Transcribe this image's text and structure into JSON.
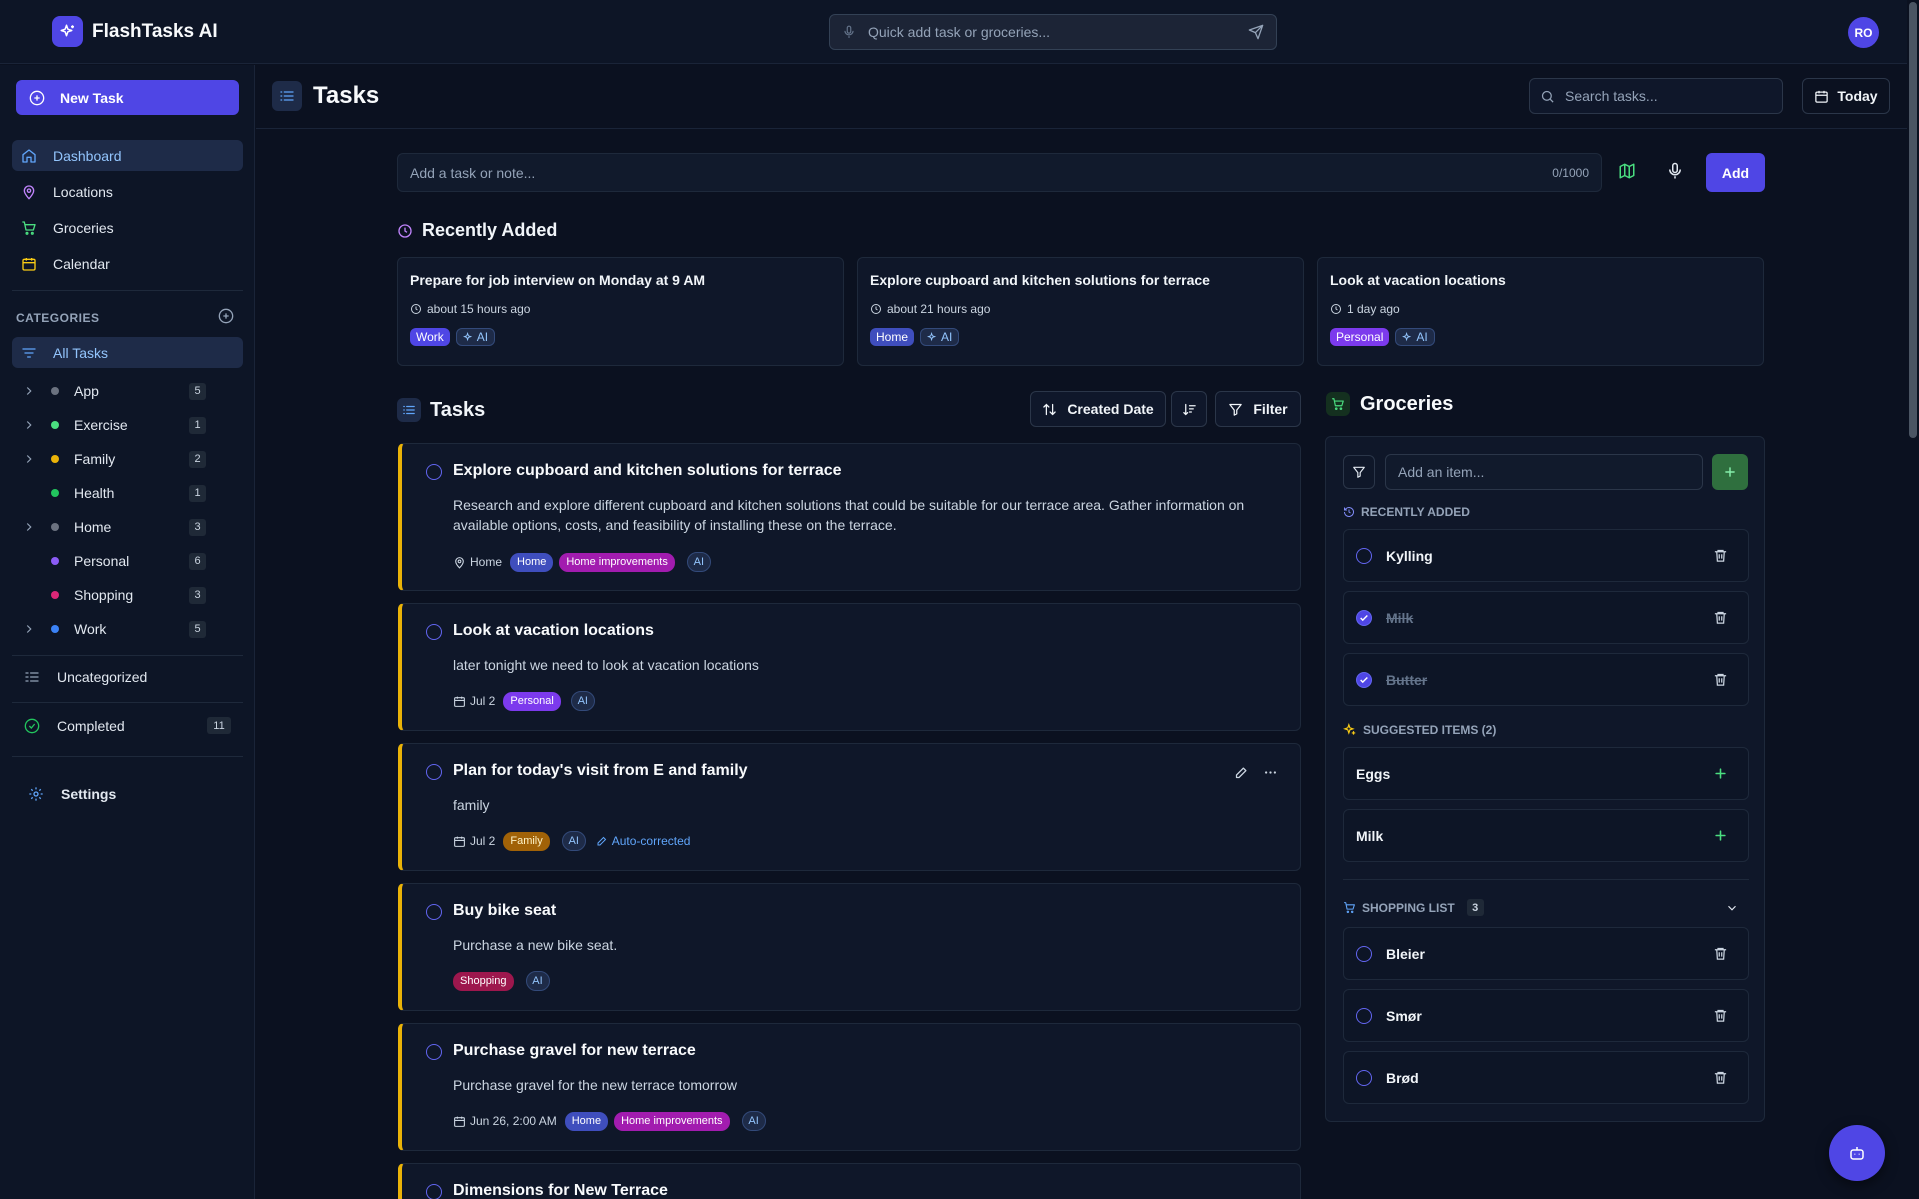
{
  "app": {
    "name": "FlashTasks AI",
    "user_initials": "RO"
  },
  "topbar": {
    "quick_add_placeholder": "Quick add task or groceries..."
  },
  "sidebar": {
    "new_task_label": "New Task",
    "nav": [
      {
        "label": "Dashboard",
        "icon": "home-icon",
        "active": true
      },
      {
        "label": "Locations",
        "icon": "map-pin-icon"
      },
      {
        "label": "Groceries",
        "icon": "cart-icon"
      },
      {
        "label": "Calendar",
        "icon": "calendar-icon"
      }
    ],
    "categories_label": "CATEGORIES",
    "all_tasks_label": "All Tasks",
    "categories": [
      {
        "name": "App",
        "count": "5",
        "color": "#6b7280",
        "expandable": true
      },
      {
        "name": "Exercise",
        "count": "1",
        "color": "#4ade80",
        "expandable": true
      },
      {
        "name": "Family",
        "count": "2",
        "color": "#eab308",
        "expandable": true
      },
      {
        "name": "Health",
        "count": "1",
        "color": "#22c55e",
        "expandable": false
      },
      {
        "name": "Home",
        "count": "3",
        "color": "#6b7280",
        "expandable": true
      },
      {
        "name": "Personal",
        "count": "6",
        "color": "#8b5cf6",
        "expandable": false
      },
      {
        "name": "Shopping",
        "count": "3",
        "color": "#db2777",
        "expandable": false
      },
      {
        "name": "Work",
        "count": "5",
        "color": "#3b82f6",
        "expandable": true
      }
    ],
    "uncategorized_label": "Uncategorized",
    "completed_label": "Completed",
    "completed_count": "11",
    "settings_label": "Settings"
  },
  "header": {
    "title": "Tasks",
    "search_placeholder": "Search tasks...",
    "today_label": "Today"
  },
  "composer": {
    "placeholder": "Add a task or note...",
    "char_count": "0/1000",
    "add_label": "Add"
  },
  "recent": {
    "title": "Recently Added",
    "items": [
      {
        "title": "Prepare for job interview on Monday at 9 AM",
        "time": "about 15 hours ago",
        "tag": "Work",
        "tag_class": "tag-work",
        "ai": "AI"
      },
      {
        "title": "Explore cupboard and kitchen solutions for terrace",
        "time": "about 21 hours ago",
        "tag": "Home",
        "tag_class": "tag-home",
        "ai": "AI"
      },
      {
        "title": "Look at vacation locations",
        "time": "1 day ago",
        "tag": "Personal",
        "tag_class": "tag-personal",
        "ai": "AI"
      }
    ]
  },
  "tasks": {
    "title": "Tasks",
    "sort_label": "Created Date",
    "filter_label": "Filter",
    "items": [
      {
        "title": "Explore cupboard and kitchen solutions for terrace",
        "description": "Research and explore different cupboard and kitchen solutions that could be suitable for our terrace area. Gather information on available options, costs, and feasibility of installing these on the terrace.",
        "meta": "Home",
        "meta_icon": "map-pin-icon",
        "tags": [
          {
            "label": "Home",
            "cls": "tag-home"
          },
          {
            "label": "Home improvements",
            "cls": "tag-improv"
          }
        ],
        "ai": "AI"
      },
      {
        "title": "Look at vacation locations",
        "description": "later tonight we need to look at vacation locations",
        "meta": "Jul 2",
        "meta_icon": "calendar-icon",
        "tags": [
          {
            "label": "Personal",
            "cls": "tag-personal"
          }
        ],
        "ai": "AI"
      },
      {
        "title": "Plan for today's visit from E and family",
        "description": "family",
        "meta": "Jul 2",
        "meta_icon": "calendar-icon",
        "tags": [
          {
            "label": "Family",
            "cls": "tag-family"
          }
        ],
        "ai": "AI",
        "extra": "Auto-corrected",
        "actions": true
      },
      {
        "title": "Buy bike seat",
        "description": "Purchase a new bike seat.",
        "tags": [
          {
            "label": "Shopping",
            "cls": "tag-shopping"
          }
        ],
        "ai": "AI"
      },
      {
        "title": "Purchase gravel for new terrace",
        "description": "Purchase gravel for the new terrace tomorrow",
        "meta": "Jun 26, 2:00 AM",
        "meta_icon": "calendar-icon",
        "tags": [
          {
            "label": "Home",
            "cls": "tag-home"
          },
          {
            "label": "Home improvements",
            "cls": "tag-improv"
          }
        ],
        "ai": "AI"
      },
      {
        "title": "Dimensions for New Terrace"
      }
    ]
  },
  "groceries": {
    "title": "Groceries",
    "input_placeholder": "Add an item...",
    "recent_label": "RECENTLY ADDED",
    "recent_items": [
      {
        "name": "Kylling",
        "done": false
      },
      {
        "name": "Milk",
        "done": true
      },
      {
        "name": "Butter",
        "done": true
      }
    ],
    "suggested_label": "SUGGESTED ITEMS (2)",
    "suggested_items": [
      {
        "name": "Eggs"
      },
      {
        "name": "Milk"
      }
    ],
    "shopping_label": "SHOPPING LIST",
    "shopping_count": "3",
    "shopping_items": [
      {
        "name": "Bleier",
        "done": false
      },
      {
        "name": "Smør",
        "done": false
      },
      {
        "name": "Brød",
        "done": false
      }
    ]
  }
}
